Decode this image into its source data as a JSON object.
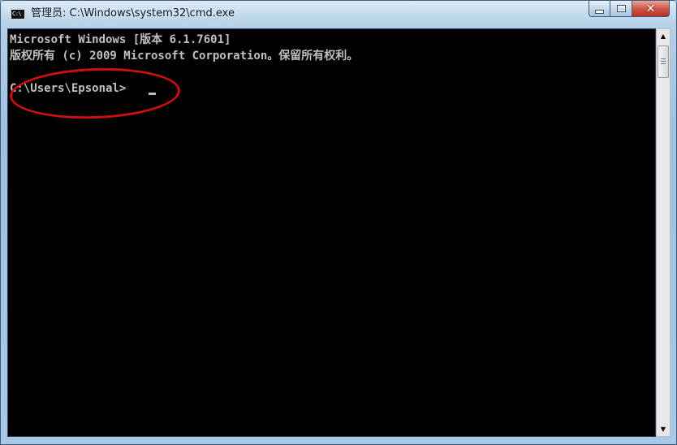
{
  "window": {
    "title": "管理员: C:\\Windows\\system32\\cmd.exe",
    "icon_name": "cmd-icon",
    "icon_text": "C:\\",
    "controls": {
      "minimize": "minimize-icon",
      "maximize": "maximize-icon",
      "close": "close-icon",
      "close_glyph": "✕"
    }
  },
  "console": {
    "lines": [
      "Microsoft Windows [版本 6.1.7601]",
      "版权所有 (c) 2009 Microsoft Corporation。保留所有权利。",
      "C:\\Users\\Epsonal>"
    ],
    "text_color": "#c0c0c0",
    "background": "#000000",
    "highlight_color": "#cc1010"
  },
  "scrollbar": {
    "up_glyph": "▲",
    "down_glyph": "▼"
  }
}
